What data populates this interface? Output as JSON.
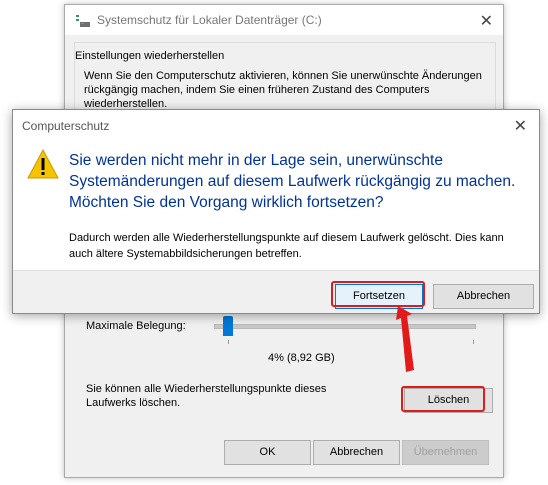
{
  "back_window": {
    "title": "Systemschutz für Lokaler Datenträger (C:)",
    "group_title": "Einstellungen wiederherstellen",
    "group_text": "Wenn Sie den Computerschutz aktivieren, können Sie unerwünschte Änderungen rückgängig machen, indem Sie einen früheren Zustand des Computers wiederherstellen.",
    "max_usage_label": "Maximale Belegung:",
    "usage_value": "4% (8,92 GB)",
    "usage_fraction": 0.04,
    "delete_text": "Sie können alle Wiederherstellungspunkte dieses Laufwerks löschen.",
    "delete_button": "Löschen",
    "ok_button": "OK",
    "cancel_button": "Abbrechen",
    "apply_button": "Übernehmen"
  },
  "dialog": {
    "title": "Computerschutz",
    "main_instruction": "Sie werden nicht mehr in der Lage sein, unerwünschte Systemänderungen auf diesem Laufwerk rückgängig zu machen. Möchten Sie den Vorgang wirklich fortsetzen?",
    "detail": "Dadurch werden alle Wiederherstellungspunkte auf diesem Laufwerk gelöscht. Dies kann auch ältere Systemabbildsicherungen betreffen.",
    "continue_button": "Fortsetzen",
    "cancel_button": "Abbrechen"
  },
  "colors": {
    "instruction_text": "#003399",
    "highlight": "#e21a1a",
    "slider_thumb": "#0078d7"
  },
  "icons": {
    "back_title_icon": "drive-icon",
    "dialog_icon": "warning-icon"
  }
}
